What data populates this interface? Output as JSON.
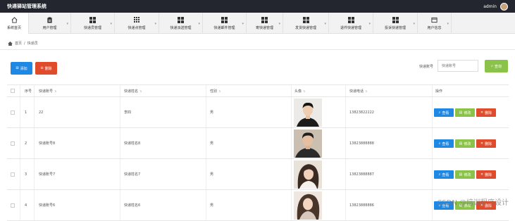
{
  "header": {
    "title": "快递驿站管理系统",
    "username": "admin"
  },
  "nav": [
    {
      "label": "系统首页",
      "icon": "home-icon",
      "active": true
    },
    {
      "label": "用户管理",
      "icon": "clipboard-icon"
    },
    {
      "label": "快递员管理",
      "icon": "grid-icon"
    },
    {
      "label": "快递点管理",
      "icon": "grid-nine-icon"
    },
    {
      "label": "快递派送管理",
      "icon": "grid-icon"
    },
    {
      "label": "快递邮件管理",
      "icon": "grid-icon"
    },
    {
      "label": "寄快递管理",
      "icon": "grid-icon"
    },
    {
      "label": "发货快递管理",
      "icon": "grid-icon"
    },
    {
      "label": "退件快递管理",
      "icon": "grid-icon"
    },
    {
      "label": "投诉快递管理",
      "icon": "grid-icon"
    },
    {
      "label": "用户信息",
      "icon": "window-icon"
    }
  ],
  "breadcrumb": {
    "home": "首页",
    "separator": "/",
    "current": "快递员"
  },
  "toolbar": {
    "add": "添加",
    "delete": "删除",
    "search_label": "快递账号",
    "search_placeholder": "快递账号",
    "search_button": "查询"
  },
  "table": {
    "headers": [
      "序号",
      "快递账号",
      "快递姓名",
      "性别",
      "头像",
      "快递电话",
      "操作"
    ],
    "rows": [
      {
        "index": "1",
        "account": "22",
        "name": "李四",
        "gender": "男",
        "phone": "13823822222"
      },
      {
        "index": "2",
        "account": "快递账号8",
        "name": "快递姓名8",
        "gender": "男",
        "phone": "13823888888"
      },
      {
        "index": "3",
        "account": "快递账号7",
        "name": "快递姓名7",
        "gender": "男",
        "phone": "13823888887"
      },
      {
        "index": "4",
        "account": "快递账号6",
        "name": "快递姓名6",
        "gender": "男",
        "phone": "13823888886"
      }
    ],
    "actions": {
      "view": "查看",
      "edit": "修改",
      "delete": "删除"
    }
  },
  "watermark": "CSDN @培训程序设计",
  "colors": {
    "topbar": "#23262e",
    "blue": "#1e88e5",
    "red": "#e04b2c",
    "green": "#8bc34a"
  }
}
